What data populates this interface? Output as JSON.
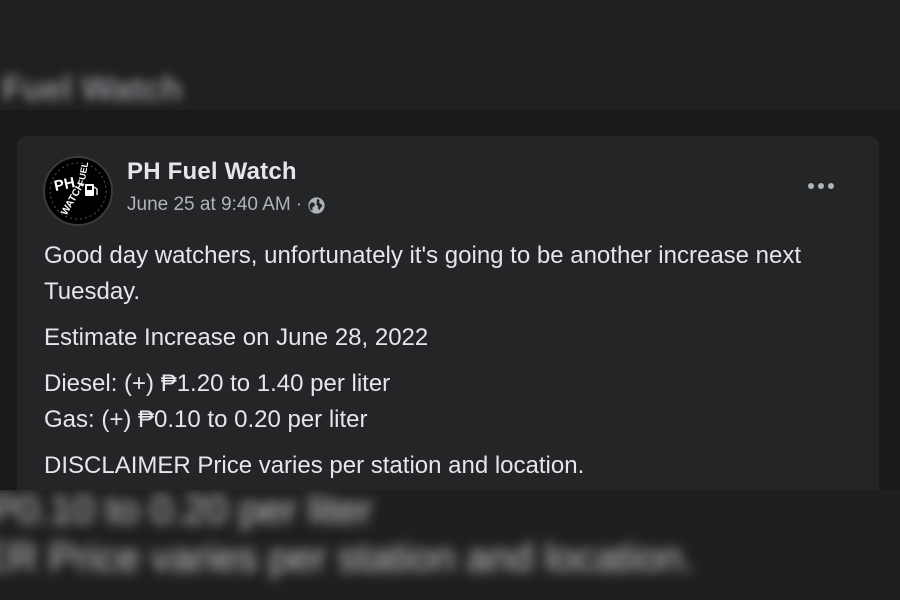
{
  "background": {
    "top_text": "Fuel Watch",
    "bottom_line1": "P0.10 to 0.20 per liter",
    "bottom_line2": "ER Price varies per station and location."
  },
  "post": {
    "page_name": "PH Fuel Watch",
    "timestamp": "June 25 at 9:40 AM",
    "meta_separator": "·",
    "privacy_icon": "globe-icon",
    "more_icon": "more-horizontal-icon",
    "avatar_logo": {
      "line1": "PH",
      "line2": "FUEL",
      "line3": "WATCH"
    },
    "body": {
      "intro": "Good day watchers, unfortunately it's going to be another increase next Tuesday.",
      "estimate": "Estimate Increase on June 28, 2022",
      "diesel": "Diesel: (+) ₱1.20 to 1.40 per liter",
      "gas": "Gas: (+) ₱0.10 to 0.20 per liter",
      "disclaimer": "DISCLAIMER Price varies per station and location."
    }
  },
  "colors": {
    "card_background": "#242526",
    "page_background": "#18191a",
    "primary_text": "#e4e6eb",
    "secondary_text": "#b0b3b8"
  }
}
